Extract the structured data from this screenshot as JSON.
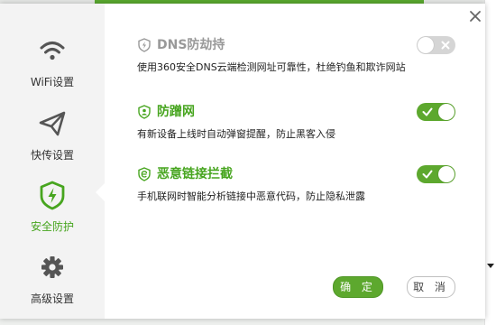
{
  "colors": {
    "accent": "#5da82e",
    "active_text": "#47a51f",
    "muted": "#999999"
  },
  "sidebar": {
    "items": [
      {
        "label": "WiFi设置",
        "icon": "wifi-icon"
      },
      {
        "label": "快传设置",
        "icon": "paper-plane-icon"
      },
      {
        "label": "安全防护",
        "icon": "shield-lightning-icon",
        "active": true
      },
      {
        "label": "高级设置",
        "icon": "gear-icon"
      }
    ]
  },
  "settings": [
    {
      "title": "DNS防劫持",
      "description": "使用360安全DNS云端检测网址可靠性，杜绝钓鱼和欺诈网站",
      "enabled": false,
      "icon": "lightning-shield-icon"
    },
    {
      "title": "防蹭网",
      "description": "有新设备上线时自动弹窗提醒，防止黑客入侵",
      "enabled": true,
      "icon": "user-shield-icon"
    },
    {
      "title": "恶意链接拦截",
      "description": "手机联网时智能分析链接中恶意代码，防止隐私泄露",
      "enabled": true,
      "icon": "link-shield-icon"
    }
  ],
  "buttons": {
    "ok": "确 定",
    "cancel": "取 消"
  }
}
